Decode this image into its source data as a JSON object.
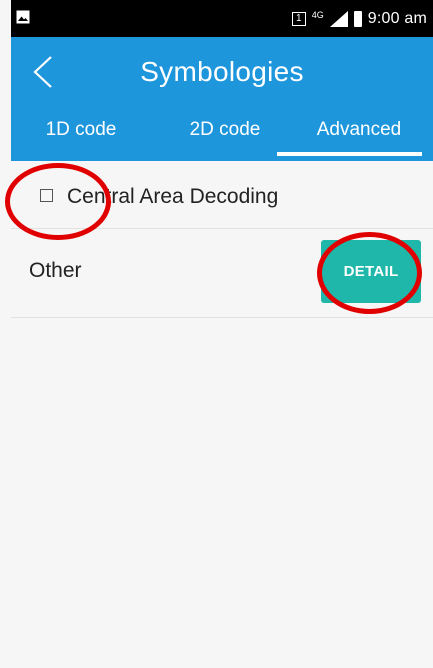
{
  "status_bar": {
    "sim_slot": "1",
    "network": "4G",
    "time": "9:00 am",
    "icons": [
      "image-icon",
      "sim-icon",
      "signal-icon",
      "battery-icon"
    ]
  },
  "app_bar": {
    "title": "Symbologies",
    "back_icon": "chevron-left-icon"
  },
  "tabs": [
    {
      "label": "1D code",
      "selected": false
    },
    {
      "label": "2D code",
      "selected": false
    },
    {
      "label": "Advanced",
      "selected": true
    }
  ],
  "settings": {
    "central_area_decoding": {
      "label": "Central Area Decoding",
      "checked": false
    },
    "other": {
      "label": "Other",
      "button_label": "DETAIL"
    }
  },
  "colors": {
    "primary": "#1e96dc",
    "accent": "#1fb7a9",
    "annotation": "#e10000",
    "background": "#f6f6f6"
  }
}
